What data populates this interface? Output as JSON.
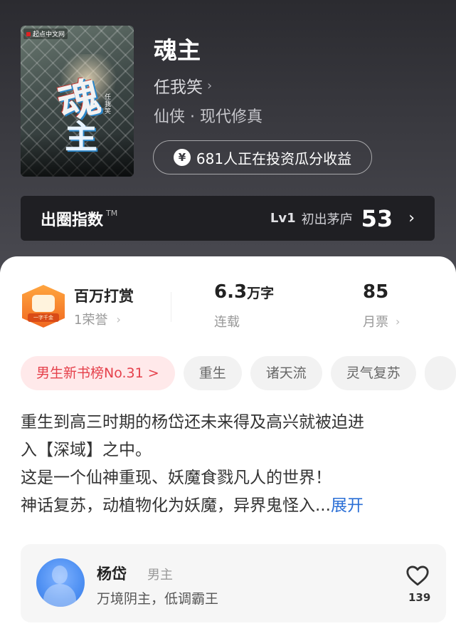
{
  "book": {
    "title": "魂主",
    "author": "任我笑",
    "author_chevron": "›",
    "genre": "仙侠 · 现代修真",
    "invest_icon": "¥",
    "invest_text": "681人正在投资瓜分收益",
    "cover": {
      "publisher": "起点中文网",
      "title_char_1": "魂",
      "title_char_2": "主",
      "author": "任我笑"
    }
  },
  "circle_index": {
    "label": "出圈指数",
    "tm": "TM",
    "level": "Lv1",
    "level_text": "初出茅庐",
    "score": "53",
    "arrow": "›"
  },
  "stats": {
    "reward": {
      "title": "百万打赏",
      "sub": "1荣誉",
      "chevron": "›",
      "badge_text": "一字千金"
    },
    "words": {
      "value": "6.3",
      "unit": "万字",
      "sub": "连载"
    },
    "tickets": {
      "value": "85",
      "sub": "月票",
      "chevron": "›"
    }
  },
  "tags": [
    "男生新书榜No.31 >",
    "重生",
    "诸天流",
    "灵气复苏",
    ""
  ],
  "description": {
    "line1": "重生到高三时期的杨岱还未来得及高兴就被迫进",
    "line2": "入【深域】之中。",
    "line3": "这是一个仙神重现、妖魔食戮凡人的世界！",
    "line4": "神话复苏，动植物化为妖魔，异界鬼怪入...",
    "more": "展开"
  },
  "role": {
    "name": "杨岱",
    "type": "男主",
    "desc": "万境阴主，低调霸王",
    "likes": "139"
  },
  "icons": {
    "author_chevron": "chevron-right-icon",
    "invest": "yen-icon",
    "circle_arrow": "chevron-right-icon",
    "reward_badge": "reward-badge-icon",
    "heart": "heart-icon"
  },
  "colors": {
    "rank_tag_text": "#e5404b",
    "rank_tag_bg": "#ffe9ea",
    "link": "#2b6fd6",
    "avatar": "#4d8ff2"
  }
}
